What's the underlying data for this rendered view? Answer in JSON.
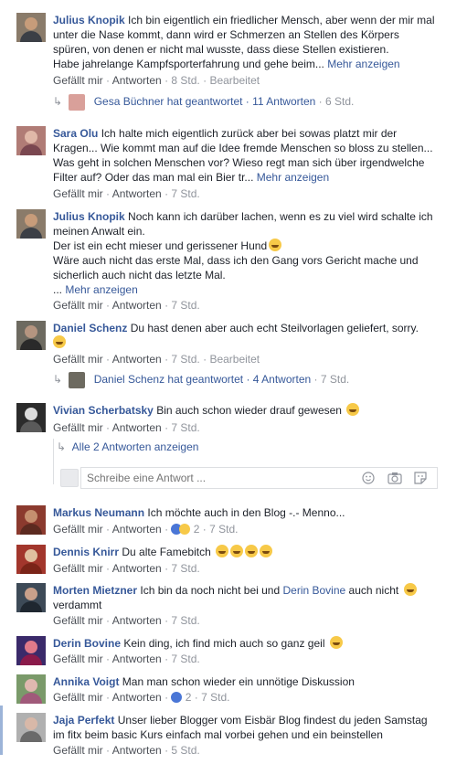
{
  "labels": {
    "like": "Gefällt mir",
    "reply": "Antworten",
    "edited": "Bearbeitet",
    "more": "Mehr anzeigen"
  },
  "comments": [
    {
      "author": "Julius Knopik",
      "lines": [
        "Ich bin eigentlich ein friedlicher Mensch, aber wenn der mir mal",
        "unter die Nase kommt, dann wird er Schmerzen an Stellen des Körpers",
        "spüren, von denen er nicht mal wusste, dass diese Stellen existieren.",
        "Habe jahrelange Kampfsporterfahrung und gehe beim..."
      ],
      "time": "8 Std."
    },
    {
      "author": "Sara Olu",
      "lines": [
        "Ich halte mich eigentlich zurück aber bei sowas platzt mir der",
        "Kragen... Wie kommt man auf die Idee fremde Menschen so bloss zu stellen...",
        "Was geht in solchen Menschen vor? Wieso regt man sich über irgendwelche",
        "Filter auf? Oder das man mal ein Bier tr..."
      ],
      "time": "7 Std."
    },
    {
      "author": "Julius Knopik",
      "lines": [
        "Noch kann ich darüber lachen, wenn es zu viel wird schalte ich",
        "meinen Anwalt ein.",
        "Der ist ein echt mieser und gerissener Hund",
        "Wäre auch nicht das erste Mal, dass ich den Gang vors Gericht mache und",
        "sicherlich auch nicht das letzte Mal.",
        "..."
      ],
      "time": "7 Std."
    },
    {
      "author": "Daniel Schenz",
      "lines": [
        "Du hast denen aber auch echt Steilvorlagen geliefert, sorry."
      ],
      "time": "7 Std."
    },
    {
      "author": "Vivian Scherbatsky",
      "lines": [
        "Bin auch schon wieder drauf gewesen"
      ],
      "time": "7 Std."
    },
    {
      "author": "Markus Neumann",
      "lines": [
        "Ich möchte auch in den Blog -.- Menno..."
      ],
      "time": "7 Std.",
      "reactions": "2"
    },
    {
      "author": "Dennis Knirr",
      "lines": [
        "Du alte Famebitch"
      ],
      "time": "7 Std."
    },
    {
      "author": "Morten Mietzner",
      "lines": [
        "Ich bin da noch nicht bei und",
        "auch nicht",
        "verdammt"
      ],
      "mention": "Derin Bovine",
      "time": "7 Std."
    },
    {
      "author": "Derin Bovine",
      "lines": [
        "Kein ding, ich find mich auch so ganz geil"
      ],
      "time": "7 Std."
    },
    {
      "author": "Annika Voigt",
      "lines": [
        "Man man schon wieder ein unnötige Diskussion"
      ],
      "time": "7 Std.",
      "reactions": "2"
    },
    {
      "author": "Jaja Perfekt",
      "lines": [
        "Unser lieber Blogger vom Eisbär Blog findest du jeden Samstag",
        "im fitx beim basic Kurs einfach mal vorbei gehen und ein beinstellen"
      ],
      "time": "5 Std."
    }
  ],
  "replies": [
    {
      "text": "Gesa Büchner hat geantwortet",
      "count": "11 Antworten",
      "time": "6 Std."
    },
    {
      "text": "Daniel Schenz hat geantwortet",
      "count": "4 Antworten",
      "time": "7 Std."
    }
  ],
  "show_replies": "Alle 2 Antworten anzeigen",
  "reply_placeholder": "Schreibe eine Antwort ...",
  "colors": {
    "link": "#365899",
    "meta": "#90949c",
    "action": "#4b4f56"
  }
}
